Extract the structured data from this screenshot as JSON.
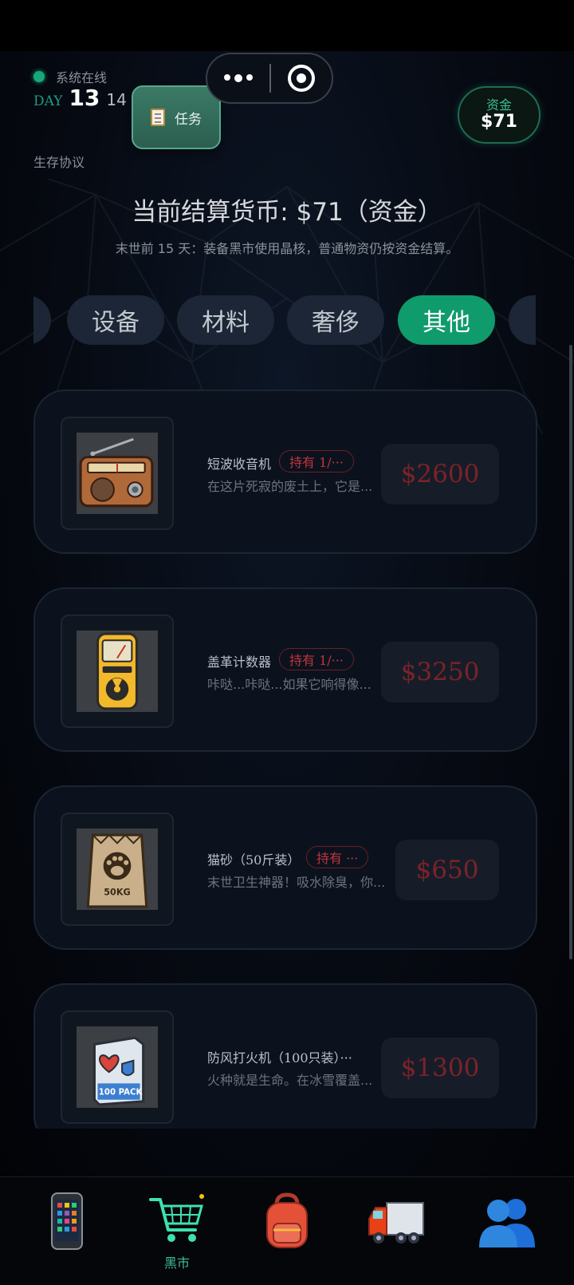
{
  "header": {
    "status_text": "系统在线",
    "day_label": "DAY",
    "day_current": "13",
    "day_total": "14",
    "protocol_label": "生存协议",
    "task_button_label": "任务",
    "funds_label": "资金",
    "funds_value": "$71"
  },
  "main": {
    "heading": "当前结算货币: $71（资金）",
    "subheading": "末世前 15 天：装备黑市使用晶核，普通物资仍按资金结算。"
  },
  "tabs": [
    {
      "label": "",
      "active": false
    },
    {
      "label": "设备",
      "active": false
    },
    {
      "label": "材料",
      "active": false
    },
    {
      "label": "奢侈",
      "active": false
    },
    {
      "label": "其他",
      "active": true
    },
    {
      "label": "",
      "active": false
    }
  ],
  "items": [
    {
      "name": "短波收音机",
      "owned": "持有 1/···",
      "desc": "在这片死寂的废土上，它是...",
      "price": "$2600",
      "icon": "radio-icon"
    },
    {
      "name": "盖革计数器",
      "owned": "持有 1/···",
      "desc": "咔哒...咔哒...如果它响得像...",
      "price": "$3250",
      "icon": "geiger-counter-icon"
    },
    {
      "name": "猫砂（50斤装）",
      "owned": "持有 ···",
      "desc": "末世卫生神器！吸水除臭，你...",
      "price": "$650",
      "icon": "cat-litter-bag-icon",
      "bag_label": "50KG"
    },
    {
      "name": "防风打火机（100只装）···",
      "owned": "",
      "desc": "火种就是生命。在冰雪覆盖...",
      "price": "$1300",
      "icon": "lighter-box-icon",
      "box_label": "100 PACK"
    }
  ],
  "bottom_nav": [
    {
      "icon": "phone-icon",
      "label": ""
    },
    {
      "icon": "shopping-cart-icon",
      "label": "黑市",
      "active": true
    },
    {
      "icon": "backpack-icon",
      "label": ""
    },
    {
      "icon": "truck-icon",
      "label": ""
    },
    {
      "icon": "people-icon",
      "label": ""
    }
  ],
  "colors": {
    "accent_green": "#0f9b6c",
    "price_red": "#7d2228",
    "owned_red": "#c0343c",
    "card_bg": "#0b121d"
  }
}
